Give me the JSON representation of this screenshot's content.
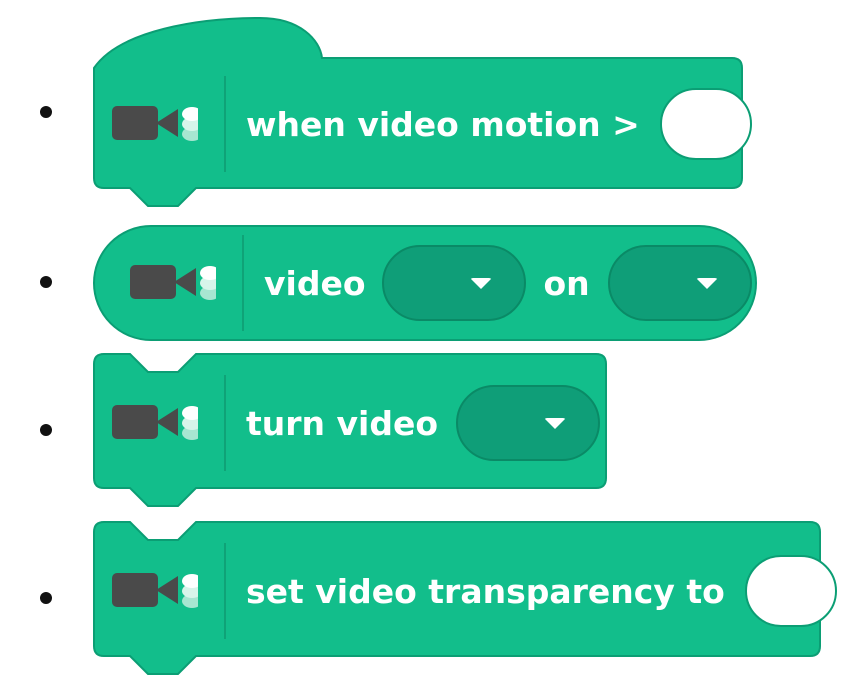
{
  "colors": {
    "block_fill": "#12be8b",
    "block_stroke": "#0b9e74",
    "dropdown_fill": "#0f9e78",
    "icon_dark": "#4a4a4a",
    "text": "#ffffff"
  },
  "blocks": [
    {
      "kind": "hat",
      "icon": "video-camera-icon",
      "label": "when video motion >",
      "input": "number-input"
    },
    {
      "kind": "reporter",
      "icon": "video-camera-icon",
      "label_1": "video",
      "dropdown_1": "attribute-dropdown",
      "label_2": "on",
      "dropdown_2": "subject-dropdown"
    },
    {
      "kind": "command",
      "icon": "video-camera-icon",
      "label": "turn video",
      "dropdown": "video-state-dropdown"
    },
    {
      "kind": "command",
      "icon": "video-camera-icon",
      "label": "set video transparency to",
      "input": "number-input"
    }
  ]
}
